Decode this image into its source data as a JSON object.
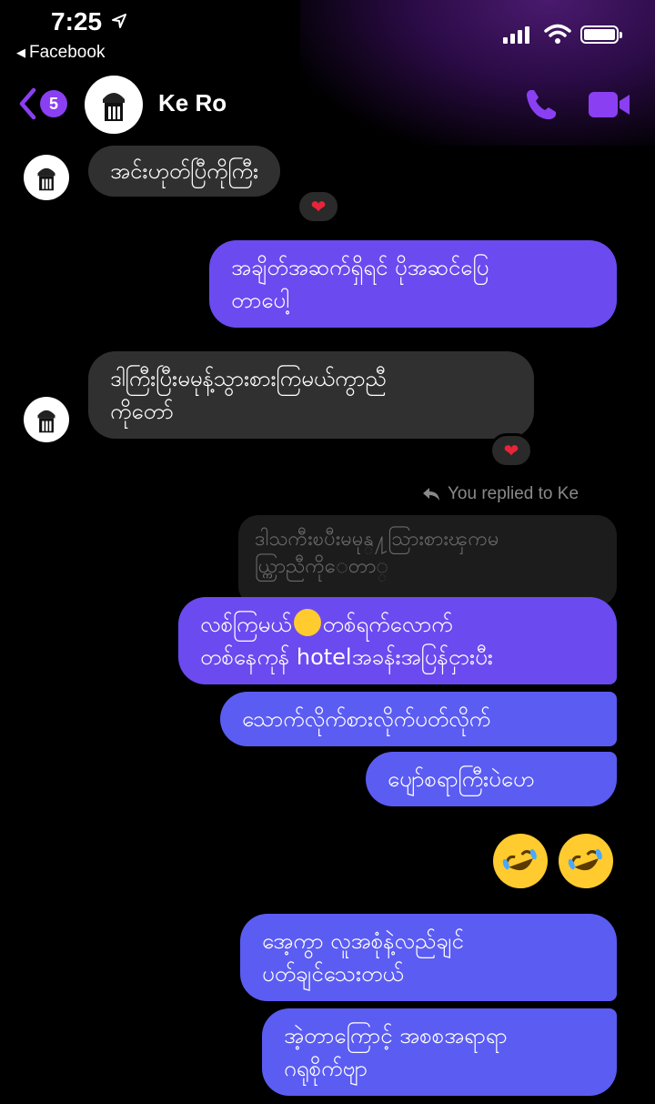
{
  "status": {
    "time": "7:25",
    "back_app": "Facebook"
  },
  "header": {
    "unread_count": "5",
    "contact_name": "Ke Ro"
  },
  "messages": [
    {
      "text": "အင်းဟုတ်ပြီကိုကြီး",
      "reaction": "❤"
    },
    {
      "text": "အချိတ်အဆက်ရှိရင် ပိုအဆင်ပြေ\nတာပေါ့"
    },
    {
      "text": "ဒါကြီးပြီးမမုန့်သွားစားကြမယ်ကွာညီ\nကိုတော်",
      "reaction": "❤"
    },
    {
      "reply_label": "You replied to Ke",
      "quoted": "ဒါသကီးၿပီးမမုန္႔သြားစားၾကမ\nယ္ကြာညီကိုေတာ္"
    },
    {
      "text_a": "လစ်ကြမယ်",
      "text_b": "တစ်ရက်လောက်\nတစ်နေကုန် hotelအခန်းအပြန်ငှားပီး"
    },
    {
      "text": "သောက်လိုက်စားလိုက်ပတ်လိုက်"
    },
    {
      "text": "ပျော်စရာကြီးပဲဟေ"
    },
    {
      "text": "အေ့ကွာ လူအစုံနဲ့လည်ချင်\nပတ်ချင်သေးတယ်"
    },
    {
      "text": "အဲ့တာကြောင့် အစစအရာရာ\nဂရုစိုက်ဗျာ"
    }
  ],
  "colors": {
    "accent": "#8a3ff2",
    "bubble_out_purple": "#6b4af0",
    "bubble_out_blue": "#5b5cf2",
    "bubble_in": "#303030"
  }
}
